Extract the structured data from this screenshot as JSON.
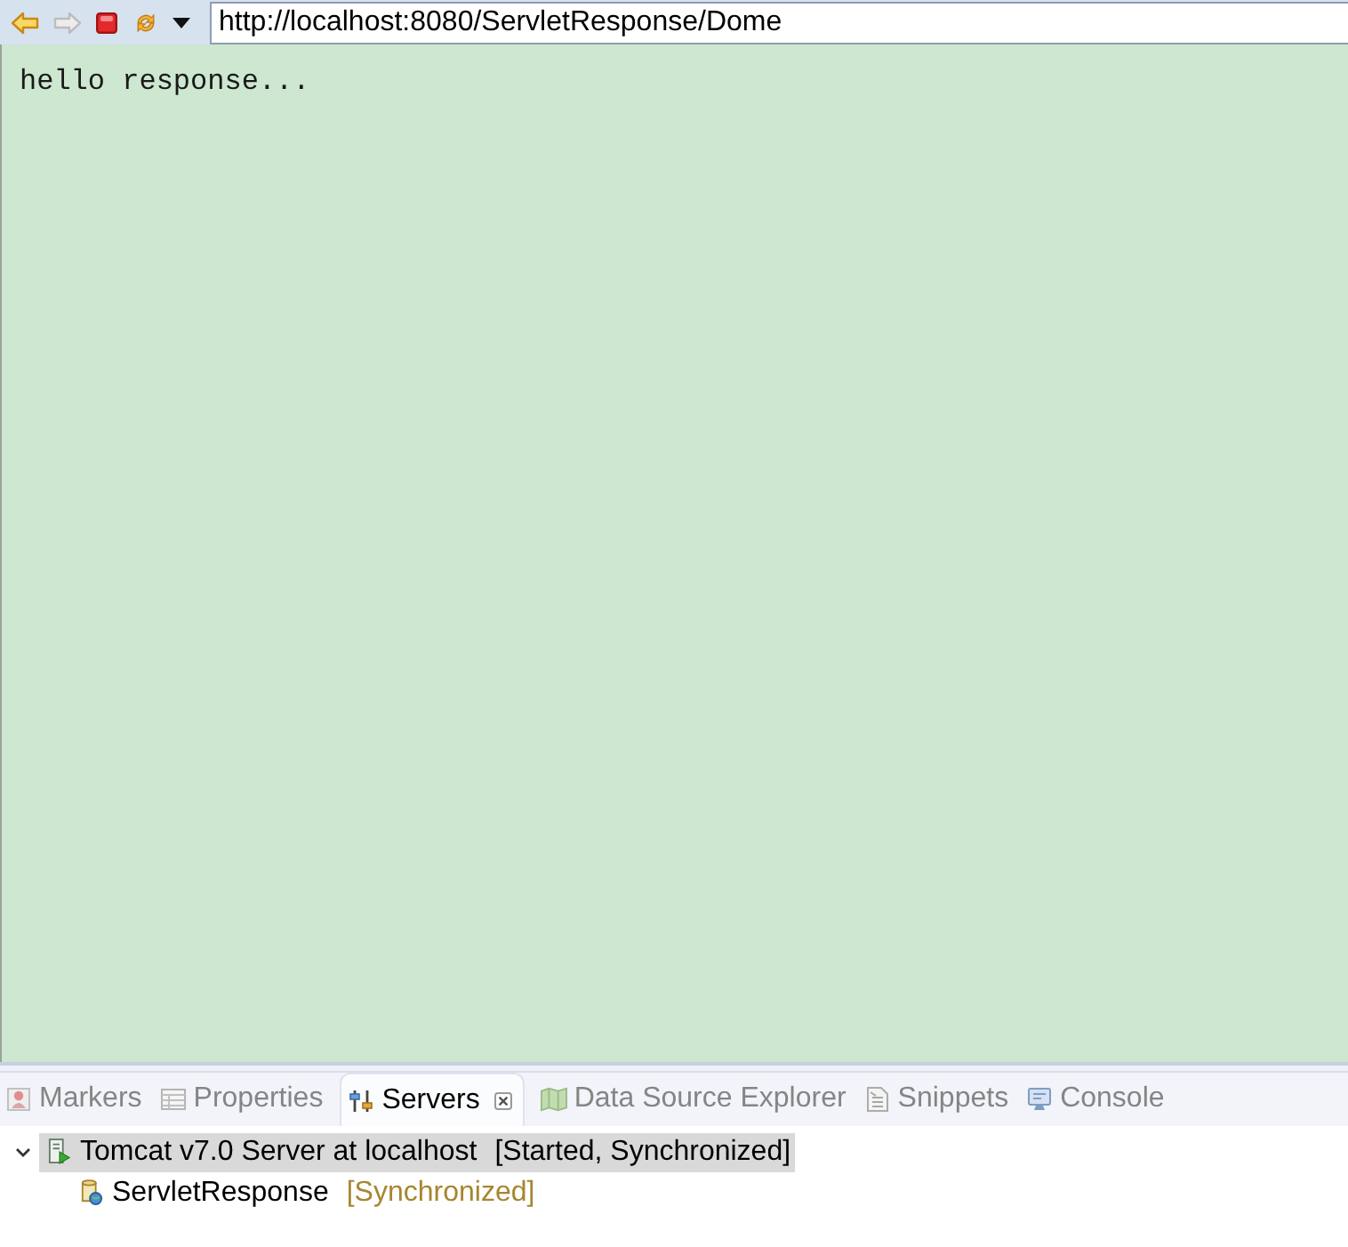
{
  "toolbar": {
    "buttons": [
      {
        "kind": "back",
        "disabled": false
      },
      {
        "kind": "forward",
        "disabled": true
      },
      {
        "kind": "stop",
        "disabled": false
      },
      {
        "kind": "refresh",
        "disabled": false
      },
      {
        "kind": "menu",
        "disabled": false
      }
    ],
    "url": "http://localhost:8080/ServletResponse/Dome"
  },
  "page": {
    "text": "hello response..."
  },
  "panel": {
    "tabs": [
      {
        "label": "Markers",
        "kind": "markers",
        "selected": false
      },
      {
        "label": "Properties",
        "kind": "properties",
        "selected": false
      },
      {
        "label": "Servers",
        "kind": "servers",
        "selected": true
      },
      {
        "label": "Data Source Explorer",
        "kind": "datasource",
        "selected": false
      },
      {
        "label": "Snippets",
        "kind": "snippets",
        "selected": false
      },
      {
        "label": "Console",
        "kind": "console",
        "selected": false
      }
    ],
    "servers": [
      {
        "kind": "server",
        "name": "Tomcat v7.0 Server at localhost",
        "status": "[Started, Synchronized]",
        "expanded": true,
        "selected": true,
        "children": [
          {
            "kind": "module",
            "name": "ServletResponse",
            "status": "[Synchronized]",
            "selected": false
          }
        ]
      }
    ]
  }
}
